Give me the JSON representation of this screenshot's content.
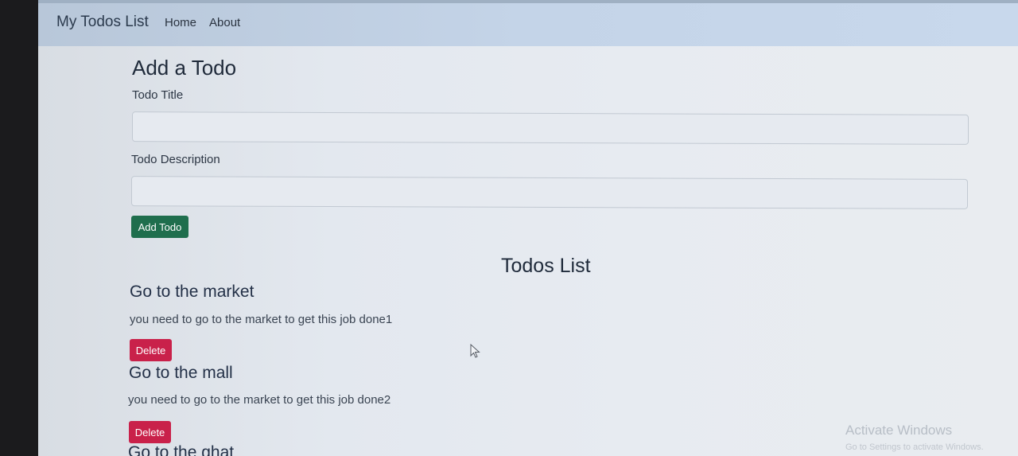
{
  "navbar": {
    "brand": "My Todos List",
    "links": [
      "Home",
      "About"
    ]
  },
  "form": {
    "heading": "Add a Todo",
    "title_label": "Todo Title",
    "title_value": "",
    "desc_label": "Todo Description",
    "desc_value": "",
    "submit_label": "Add Todo"
  },
  "list": {
    "heading": "Todos List",
    "items": [
      {
        "title": "Go to the market",
        "desc": "you need to go to the market to get this job done1",
        "delete_label": "Delete"
      },
      {
        "title": "Go to the mall",
        "desc": "you need to go to the market to get this job done2",
        "delete_label": "Delete"
      },
      {
        "title": "Go to the ghat"
      }
    ]
  },
  "watermark": {
    "title": "Activate Windows",
    "subtitle": "Go to Settings to activate Windows."
  },
  "colors": {
    "navbar": "#c4d4e8",
    "add_button": "#1f6e4d",
    "delete_button": "#c9214a"
  }
}
